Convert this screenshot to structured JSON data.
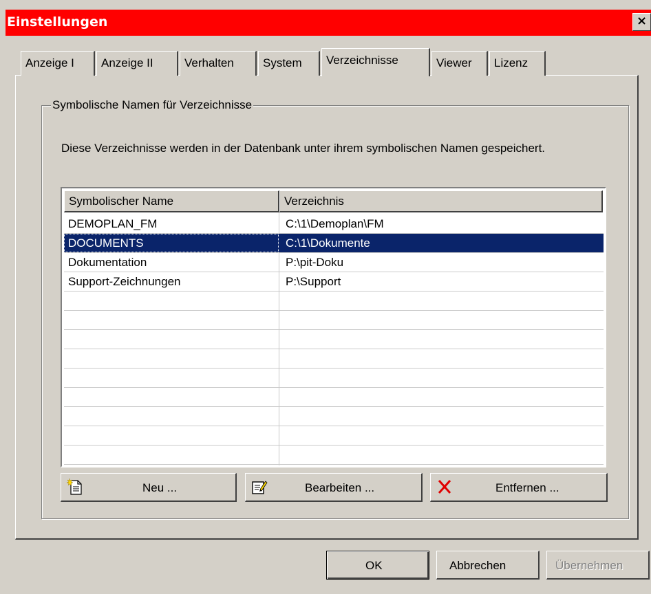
{
  "window": {
    "title": "Einstellungen",
    "close_glyph": "×"
  },
  "tabs": [
    {
      "label": "Anzeige I"
    },
    {
      "label": "Anzeige II"
    },
    {
      "label": "Verhalten"
    },
    {
      "label": "System"
    },
    {
      "label": "Verzeichnisse"
    },
    {
      "label": "Viewer"
    },
    {
      "label": "Lizenz"
    }
  ],
  "active_tab": "Verzeichnisse",
  "group": {
    "legend": "Symbolische Namen für Verzeichnisse",
    "description": "Diese Verzeichnisse werden in der Datenbank unter ihrem symbolischen Namen gespeichert."
  },
  "list": {
    "columns": [
      "Symbolischer Name",
      "Verzeichnis"
    ],
    "rows": [
      {
        "name": "DEMOPLAN_FM",
        "path": "C:\\1\\Demoplan\\FM"
      },
      {
        "name": "DOCUMENTS",
        "path": "C:\\1\\Dokumente"
      },
      {
        "name": "Dokumentation",
        "path": "P:\\pit-Doku"
      },
      {
        "name": "Support-Zeichnungen",
        "path": "P:\\Support"
      }
    ],
    "selected_row": 1
  },
  "actions": {
    "new_label": "Neu ...",
    "edit_label": "Bearbeiten ...",
    "remove_label": "Entfernen ..."
  },
  "footer": {
    "ok_label": "OK",
    "cancel_label": "Abbrechen",
    "apply_label": "Übernehmen"
  },
  "colors": {
    "titlebar": "#ff0000",
    "selection": "#0a246a",
    "face": "#d4d0c8",
    "remove_icon": "#e00000"
  },
  "icons": {
    "new": "new-document-icon",
    "edit": "edit-document-icon",
    "remove": "red-x-icon"
  }
}
